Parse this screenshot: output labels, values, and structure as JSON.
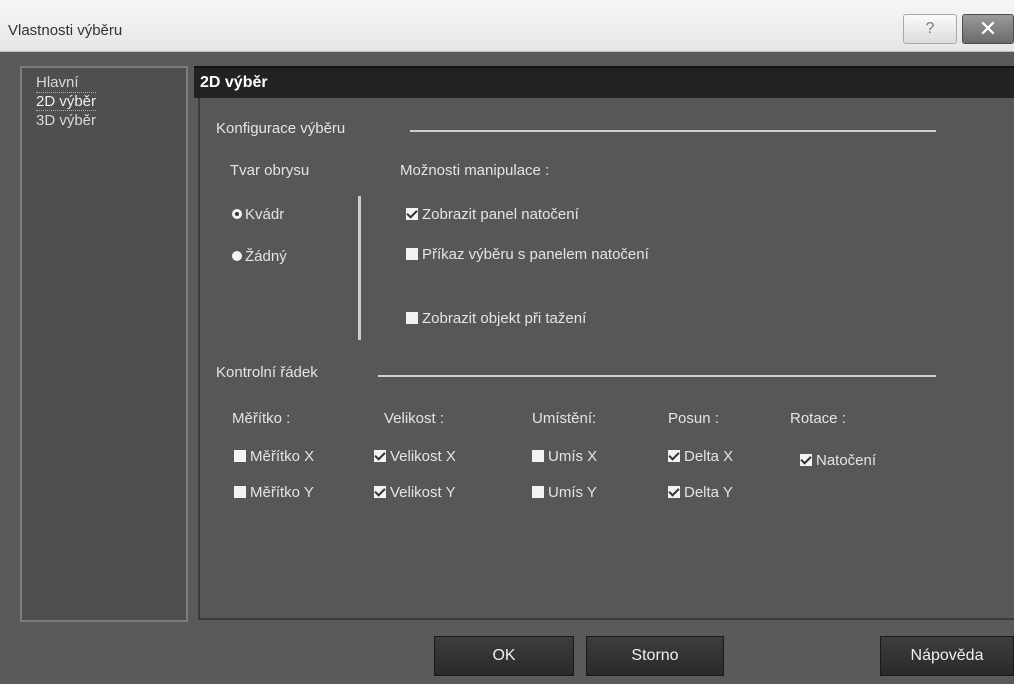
{
  "window": {
    "title": "Vlastnosti výběru",
    "help_label": "?",
    "close_label": "✕"
  },
  "nav": {
    "items": [
      {
        "label": "Hlavní"
      },
      {
        "label": "2D výběr"
      },
      {
        "label": "3D výběr"
      }
    ]
  },
  "panel": {
    "header": "2D výběr",
    "config_section": "Konfigurace výběru",
    "outline_shape": {
      "label": "Tvar obrysu",
      "options": [
        {
          "label": "Kvádr",
          "selected": true
        },
        {
          "label": "Žádný",
          "selected": false
        }
      ]
    },
    "manipulation": {
      "label": "Možnosti manipulace :",
      "options": [
        {
          "label": "Zobrazit panel natočení",
          "checked": true
        },
        {
          "label": "Příkaz výběru s panelem natočení",
          "checked": false
        },
        {
          "label": "Zobrazit objekt při tažení",
          "checked": false
        }
      ]
    },
    "control_section": "Kontrolní řádek",
    "columns": [
      {
        "header": "Měřítko :",
        "items": [
          {
            "label": "Měřítko X",
            "checked": false
          },
          {
            "label": "Měřítko Y",
            "checked": false
          }
        ]
      },
      {
        "header": "Velikost :",
        "items": [
          {
            "label": "Velikost X",
            "checked": true
          },
          {
            "label": "Velikost Y",
            "checked": true
          }
        ]
      },
      {
        "header": "Umístění:",
        "items": [
          {
            "label": "Umís X",
            "checked": false
          },
          {
            "label": "Umís Y",
            "checked": false
          }
        ]
      },
      {
        "header": "Posun :",
        "items": [
          {
            "label": "Delta X",
            "checked": true
          },
          {
            "label": "Delta Y",
            "checked": true
          }
        ]
      },
      {
        "header": "Rotace :",
        "items": [
          {
            "label": "Natočení",
            "checked": true
          }
        ]
      }
    ]
  },
  "buttons": {
    "ok": "OK",
    "cancel": "Storno",
    "help": "Nápověda"
  }
}
